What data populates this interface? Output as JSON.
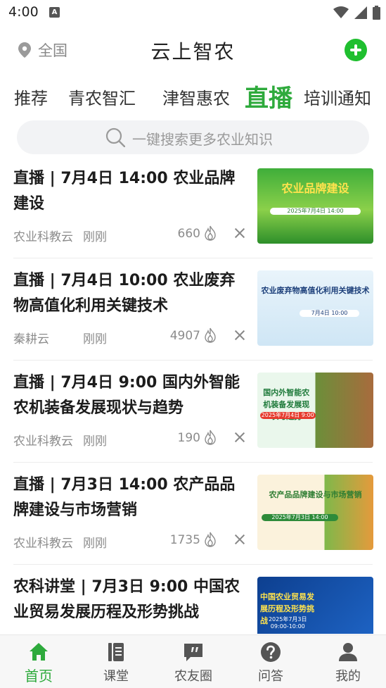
{
  "status_bar": {
    "time": "4:00",
    "notification_glyph": "A"
  },
  "header": {
    "location": "全国",
    "title": "云上智农",
    "accent_color": "#1fbf2f"
  },
  "tabs": [
    {
      "label": "推荐",
      "active": false
    },
    {
      "label": "青农智汇",
      "active": false
    },
    {
      "label": "津智惠农",
      "active": false
    },
    {
      "label": "直播",
      "active": true
    },
    {
      "label": "培训通知",
      "active": false
    }
  ],
  "search": {
    "placeholder": "一键搜索更多农业知识"
  },
  "feed": [
    {
      "title": "直播 | 7月4日 14:00 农业品牌建设",
      "source": "农业科教云",
      "time": "刚刚",
      "views": "660",
      "thumb_caption": "农业品牌建设",
      "thumb_date": "2025年7月4日 14:00"
    },
    {
      "title": "直播 | 7月4日 10:00 农业废弃物高值化利用关键技术",
      "source": "秦耕云",
      "time": "刚刚",
      "views": "4907",
      "thumb_caption": "农业废弃物高值化利用关键技术",
      "thumb_date": "7月4日 10:00"
    },
    {
      "title": "直播 | 7月4日 9:00 国内外智能农机装备发展现状与趋势",
      "source": "农业科教云",
      "time": "刚刚",
      "views": "190",
      "thumb_caption": "国内外智能农机装备发展现状与趋势",
      "thumb_date": "2025年7月4日 9:00"
    },
    {
      "title": "直播 | 7月3日 14:00 农产品品牌建设与市场营销",
      "source": "农业科教云",
      "time": "刚刚",
      "views": "1735",
      "thumb_caption": "农产品品牌建设与市场营销",
      "thumb_date": "2025年7月3日 14:00"
    },
    {
      "title": "农科讲堂 | 7月3日 9:00 中国农业贸易发展历程及形势挑战",
      "source": "",
      "time": "",
      "views": "",
      "thumb_caption": "中国农业贸易发展历程及形势挑战",
      "thumb_date": "2025年7月3日 09:00-10:00"
    }
  ],
  "bottom_nav": [
    {
      "label": "首页",
      "icon": "home-icon",
      "active": true
    },
    {
      "label": "课堂",
      "icon": "book-icon",
      "active": false
    },
    {
      "label": "农友圈",
      "icon": "chat-quote-icon",
      "active": false
    },
    {
      "label": "问答",
      "icon": "question-icon",
      "active": false
    },
    {
      "label": "我的",
      "icon": "user-icon",
      "active": false
    }
  ]
}
